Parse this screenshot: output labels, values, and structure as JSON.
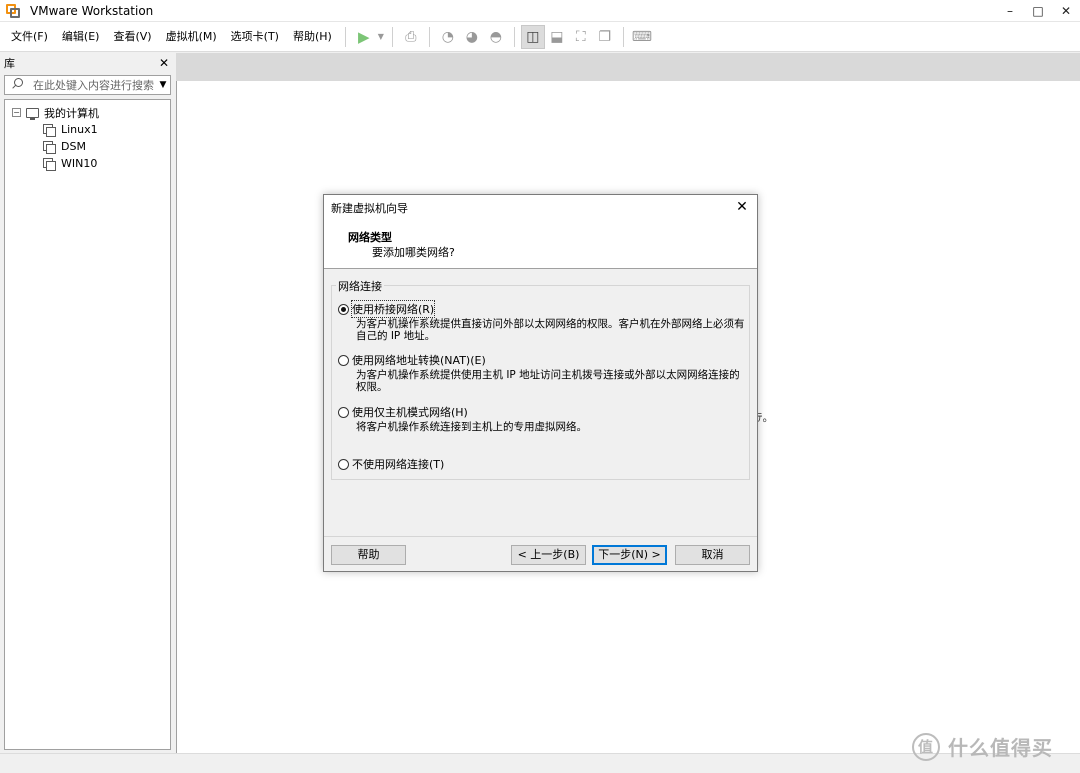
{
  "window": {
    "title": "VMware Workstation",
    "minimize": "–",
    "maximize": "□",
    "close": "✕"
  },
  "menu": [
    "文件(F)",
    "编辑(E)",
    "查看(V)",
    "虚拟机(M)",
    "选项卡(T)",
    "帮助(H)"
  ],
  "toolbar": {
    "play_icon": "play-icon",
    "items": [
      "send-keys-icon",
      "snapshot-icon",
      "revert-snapshot-icon",
      "snapshot-manager-icon",
      "library-view-icon",
      "thumbnail-bar-icon",
      "fullscreen-icon",
      "unity-icon",
      "console-icon"
    ]
  },
  "library": {
    "title": "库",
    "close": "✕",
    "search_placeholder": "在此处键入内容进行搜索",
    "dropdown": "▼"
  },
  "tree": {
    "root": "我的计算机",
    "root_expander": "⊟",
    "children": [
      "Linux1",
      "DSM",
      "WIN10"
    ]
  },
  "content": {
    "partial_text": "ﾃ。"
  },
  "dialog": {
    "title": "新建虚拟机向导",
    "close": "✕",
    "heading": "网络类型",
    "subheading": "要添加哪类网络?",
    "group_label": "网络连接",
    "options": [
      {
        "label": "使用桥接网络(R)",
        "selected": true,
        "desc": "为客户机操作系统提供直接访问外部以太网网络的权限。客户机在外部网络上必须有自己的 IP 地址。"
      },
      {
        "label": "使用网络地址转换(NAT)(E)",
        "selected": false,
        "desc": "为客户机操作系统提供使用主机 IP 地址访问主机拨号连接或外部以太网网络连接的权限。"
      },
      {
        "label": "使用仅主机模式网络(H)",
        "selected": false,
        "desc": "将客户机操作系统连接到主机上的专用虚拟网络。"
      },
      {
        "label": "不使用网络连接(T)",
        "selected": false,
        "desc": ""
      }
    ],
    "buttons": {
      "help": "帮助",
      "back": "< 上一步(B)",
      "next": "下一步(N) >",
      "cancel": "取消"
    }
  },
  "watermark": {
    "glyph": "值",
    "text": "什么值得买"
  }
}
